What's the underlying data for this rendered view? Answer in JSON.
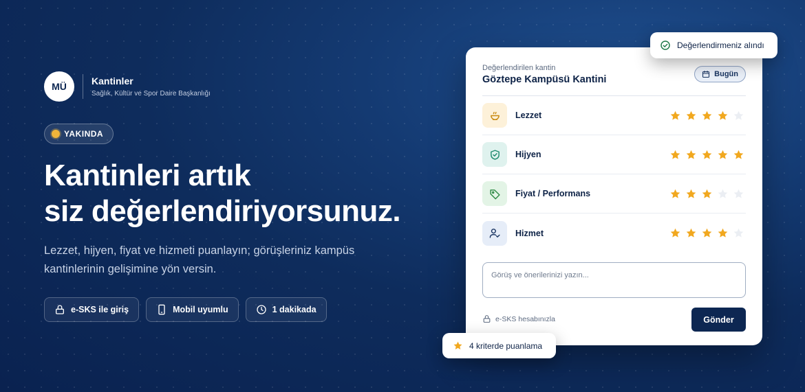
{
  "brand": {
    "logo_text": "MÜ",
    "name": "Kantinler",
    "subtitle": "Sağlık, Kültür ve Spor Daire Başkanlığı"
  },
  "badge": {
    "label": "YAKINDA"
  },
  "hero": {
    "title_line1": "Kantinleri artık",
    "title_line2": "siz değerlendiriyorsunuz.",
    "subtitle_line1": "Lezzet, hijyen, fiyat ve hizmeti puanlayın; görüşleriniz kampüs",
    "subtitle_line2": "kantinlerinin gelişimine yön versin."
  },
  "features": [
    {
      "label": "e-SKS ile giriş",
      "icon": "lock-icon"
    },
    {
      "label": "Mobil uyumlu",
      "icon": "smartphone-icon"
    },
    {
      "label": "1 dakikada",
      "icon": "clock-icon"
    }
  ],
  "card": {
    "kicker": "Değerlendirilen kantin",
    "title": "Göztepe Kampüsü Kantini",
    "date_button": "Bugün",
    "criteria": [
      {
        "label": "Lezzet",
        "icon": "bowl-icon",
        "rating": 4,
        "max": 5,
        "icon_bg": "#fdf1d9",
        "icon_color": "#c98a10"
      },
      {
        "label": "Hijyen",
        "icon": "shield-check-icon",
        "rating": 5,
        "max": 5,
        "icon_bg": "#dff2ee",
        "icon_color": "#1f8a6e"
      },
      {
        "label": "Fiyat / Performans",
        "icon": "tag-icon",
        "rating": 3,
        "max": 5,
        "icon_bg": "#e3f4e6",
        "icon_color": "#2e8a45"
      },
      {
        "label": "Hizmet",
        "icon": "user-check-icon",
        "rating": 4,
        "max": 5,
        "icon_bg": "#e6edf8",
        "icon_color": "#1a3562"
      }
    ],
    "comment_placeholder": "Görüş ve önerilerinizi yazın...",
    "login_note": "e-SKS hesabınızla",
    "submit_label": "Gönder"
  },
  "toast": {
    "text": "Değerlendirmeniz alındı",
    "icon": "check-circle-icon"
  },
  "criteria_pill": {
    "text": "4 kriterde puanlama",
    "icon": "star-icon"
  },
  "colors": {
    "accent_navy": "#0d2752",
    "star_on": "#f1a81f",
    "star_off": "#ebeef3",
    "badge_dot": "#f0b53a",
    "success": "#1f7a4a"
  }
}
